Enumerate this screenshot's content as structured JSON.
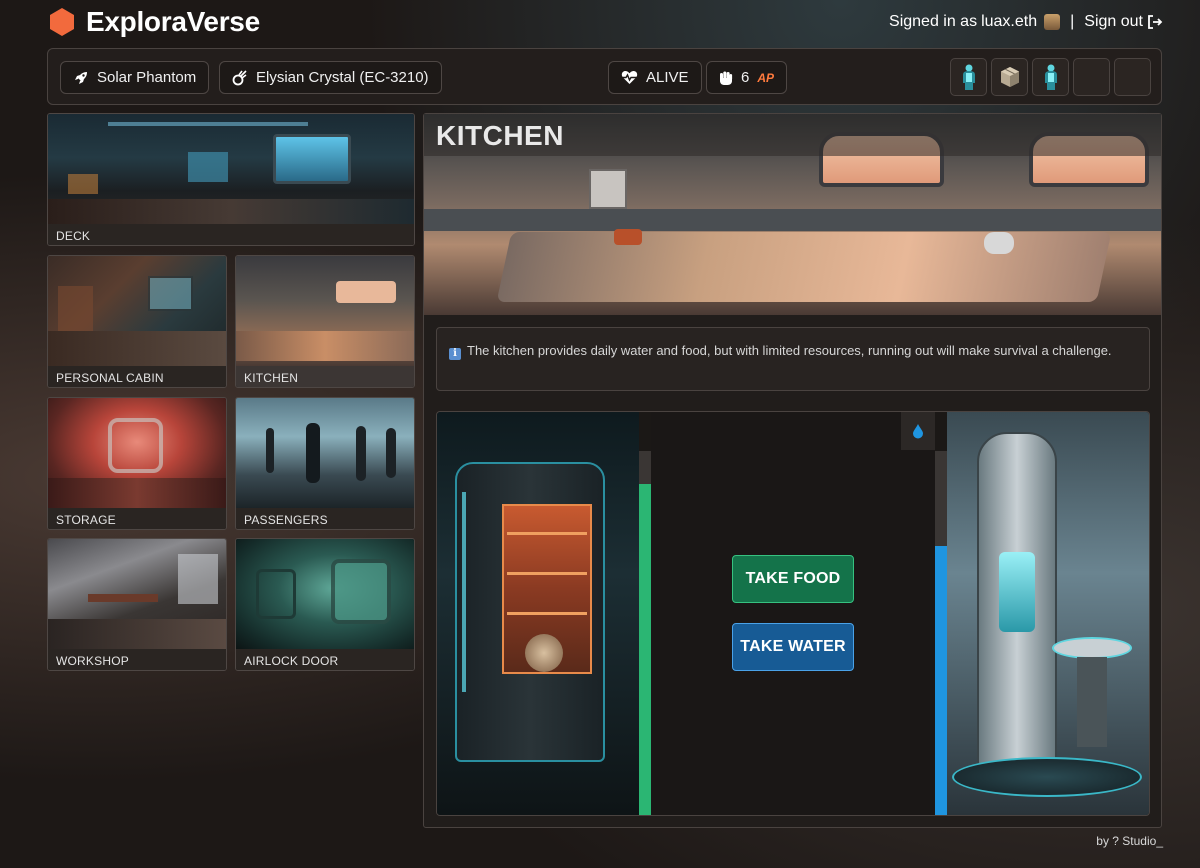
{
  "app": {
    "name": "ExploraVerse",
    "brand_color": "#f26a3d"
  },
  "user": {
    "signed_in_prefix": "Signed in as",
    "username": "luax.eth",
    "separator": "|",
    "sign_out_label": "Sign out"
  },
  "status": {
    "ship": {
      "icon": "rocket-icon",
      "label": "Solar Phantom"
    },
    "resource": {
      "icon": "meteor-icon",
      "label": "Elysian Crystal (EC-3210)"
    },
    "vitals": {
      "icon": "heartbeat-icon",
      "label": "ALIVE"
    },
    "action_points": {
      "icon": "fist-icon",
      "value": "6",
      "unit": "AP"
    },
    "inventory": [
      {
        "icon": "cyan-figure-icon",
        "filled": true
      },
      {
        "icon": "crate-icon",
        "filled": true
      },
      {
        "icon": "cyan-figure-icon",
        "filled": true
      },
      {
        "icon": "empty-slot",
        "filled": false
      },
      {
        "icon": "empty-slot",
        "filled": false
      }
    ]
  },
  "rooms": [
    {
      "id": "deck",
      "label": "DECK",
      "active": false
    },
    {
      "id": "personal-cabin",
      "label": "PERSONAL CABIN",
      "active": false
    },
    {
      "id": "kitchen",
      "label": "KITCHEN",
      "active": true
    },
    {
      "id": "storage",
      "label": "STORAGE",
      "active": false
    },
    {
      "id": "passengers",
      "label": "PASSENGERS",
      "active": false
    },
    {
      "id": "workshop",
      "label": "WORKSHOP",
      "active": false
    },
    {
      "id": "airlock-door",
      "label": "AIRLOCK DOOR",
      "active": false
    }
  ],
  "current_room": {
    "title": "KITCHEN",
    "info_icon": "info-icon",
    "description": "The kitchen provides daily water and food, but with limited resources, running out will make survival a challenge."
  },
  "supplies": {
    "food": {
      "icon": "bowl-icon",
      "level": 0.91,
      "color": "#2bb673",
      "button_label": "TAKE FOOD"
    },
    "water": {
      "icon": "droplet-icon",
      "level": 0.74,
      "color": "#1f95e0",
      "button_label": "TAKE WATER"
    }
  },
  "footer": {
    "credit": "by ? Studio_"
  }
}
